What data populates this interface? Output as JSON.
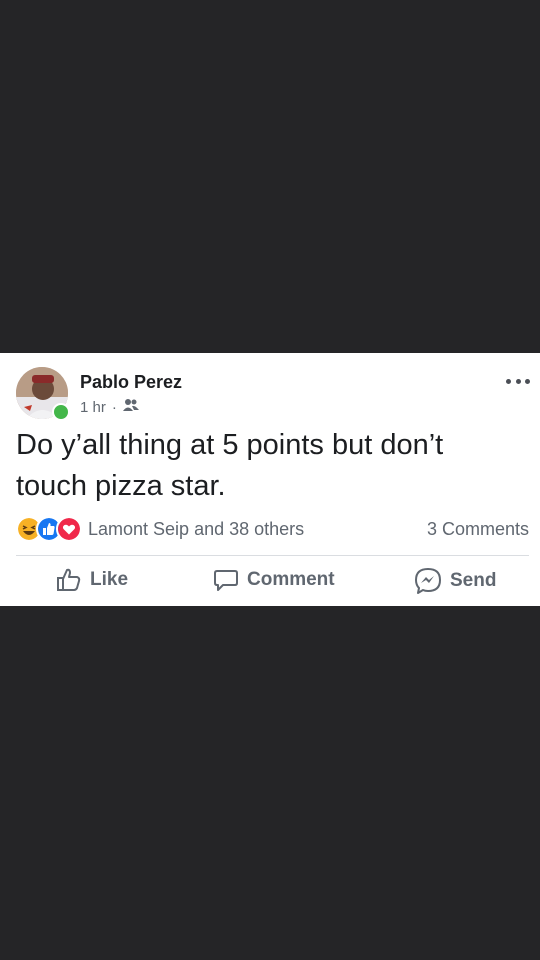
{
  "post": {
    "author": "Pablo Perez",
    "time": "1 hr",
    "privacy_icon": "friends-icon",
    "text": "Do y’all thing at 5 points but don’t touch pizza star.",
    "reactions": {
      "types": [
        "haha",
        "like",
        "love"
      ],
      "summary": "Lamont Seip and 38 others"
    },
    "comments_count": "3 Comments"
  },
  "actions": {
    "like": "Like",
    "comment": "Comment",
    "send": "Send"
  },
  "colors": {
    "background": "#252527",
    "card": "#ffffff",
    "secondary_text": "#606770",
    "online": "#44b74a",
    "like_blue": "#1877f2",
    "love_red": "#f0284a",
    "haha_yellow": "#f7b125"
  }
}
